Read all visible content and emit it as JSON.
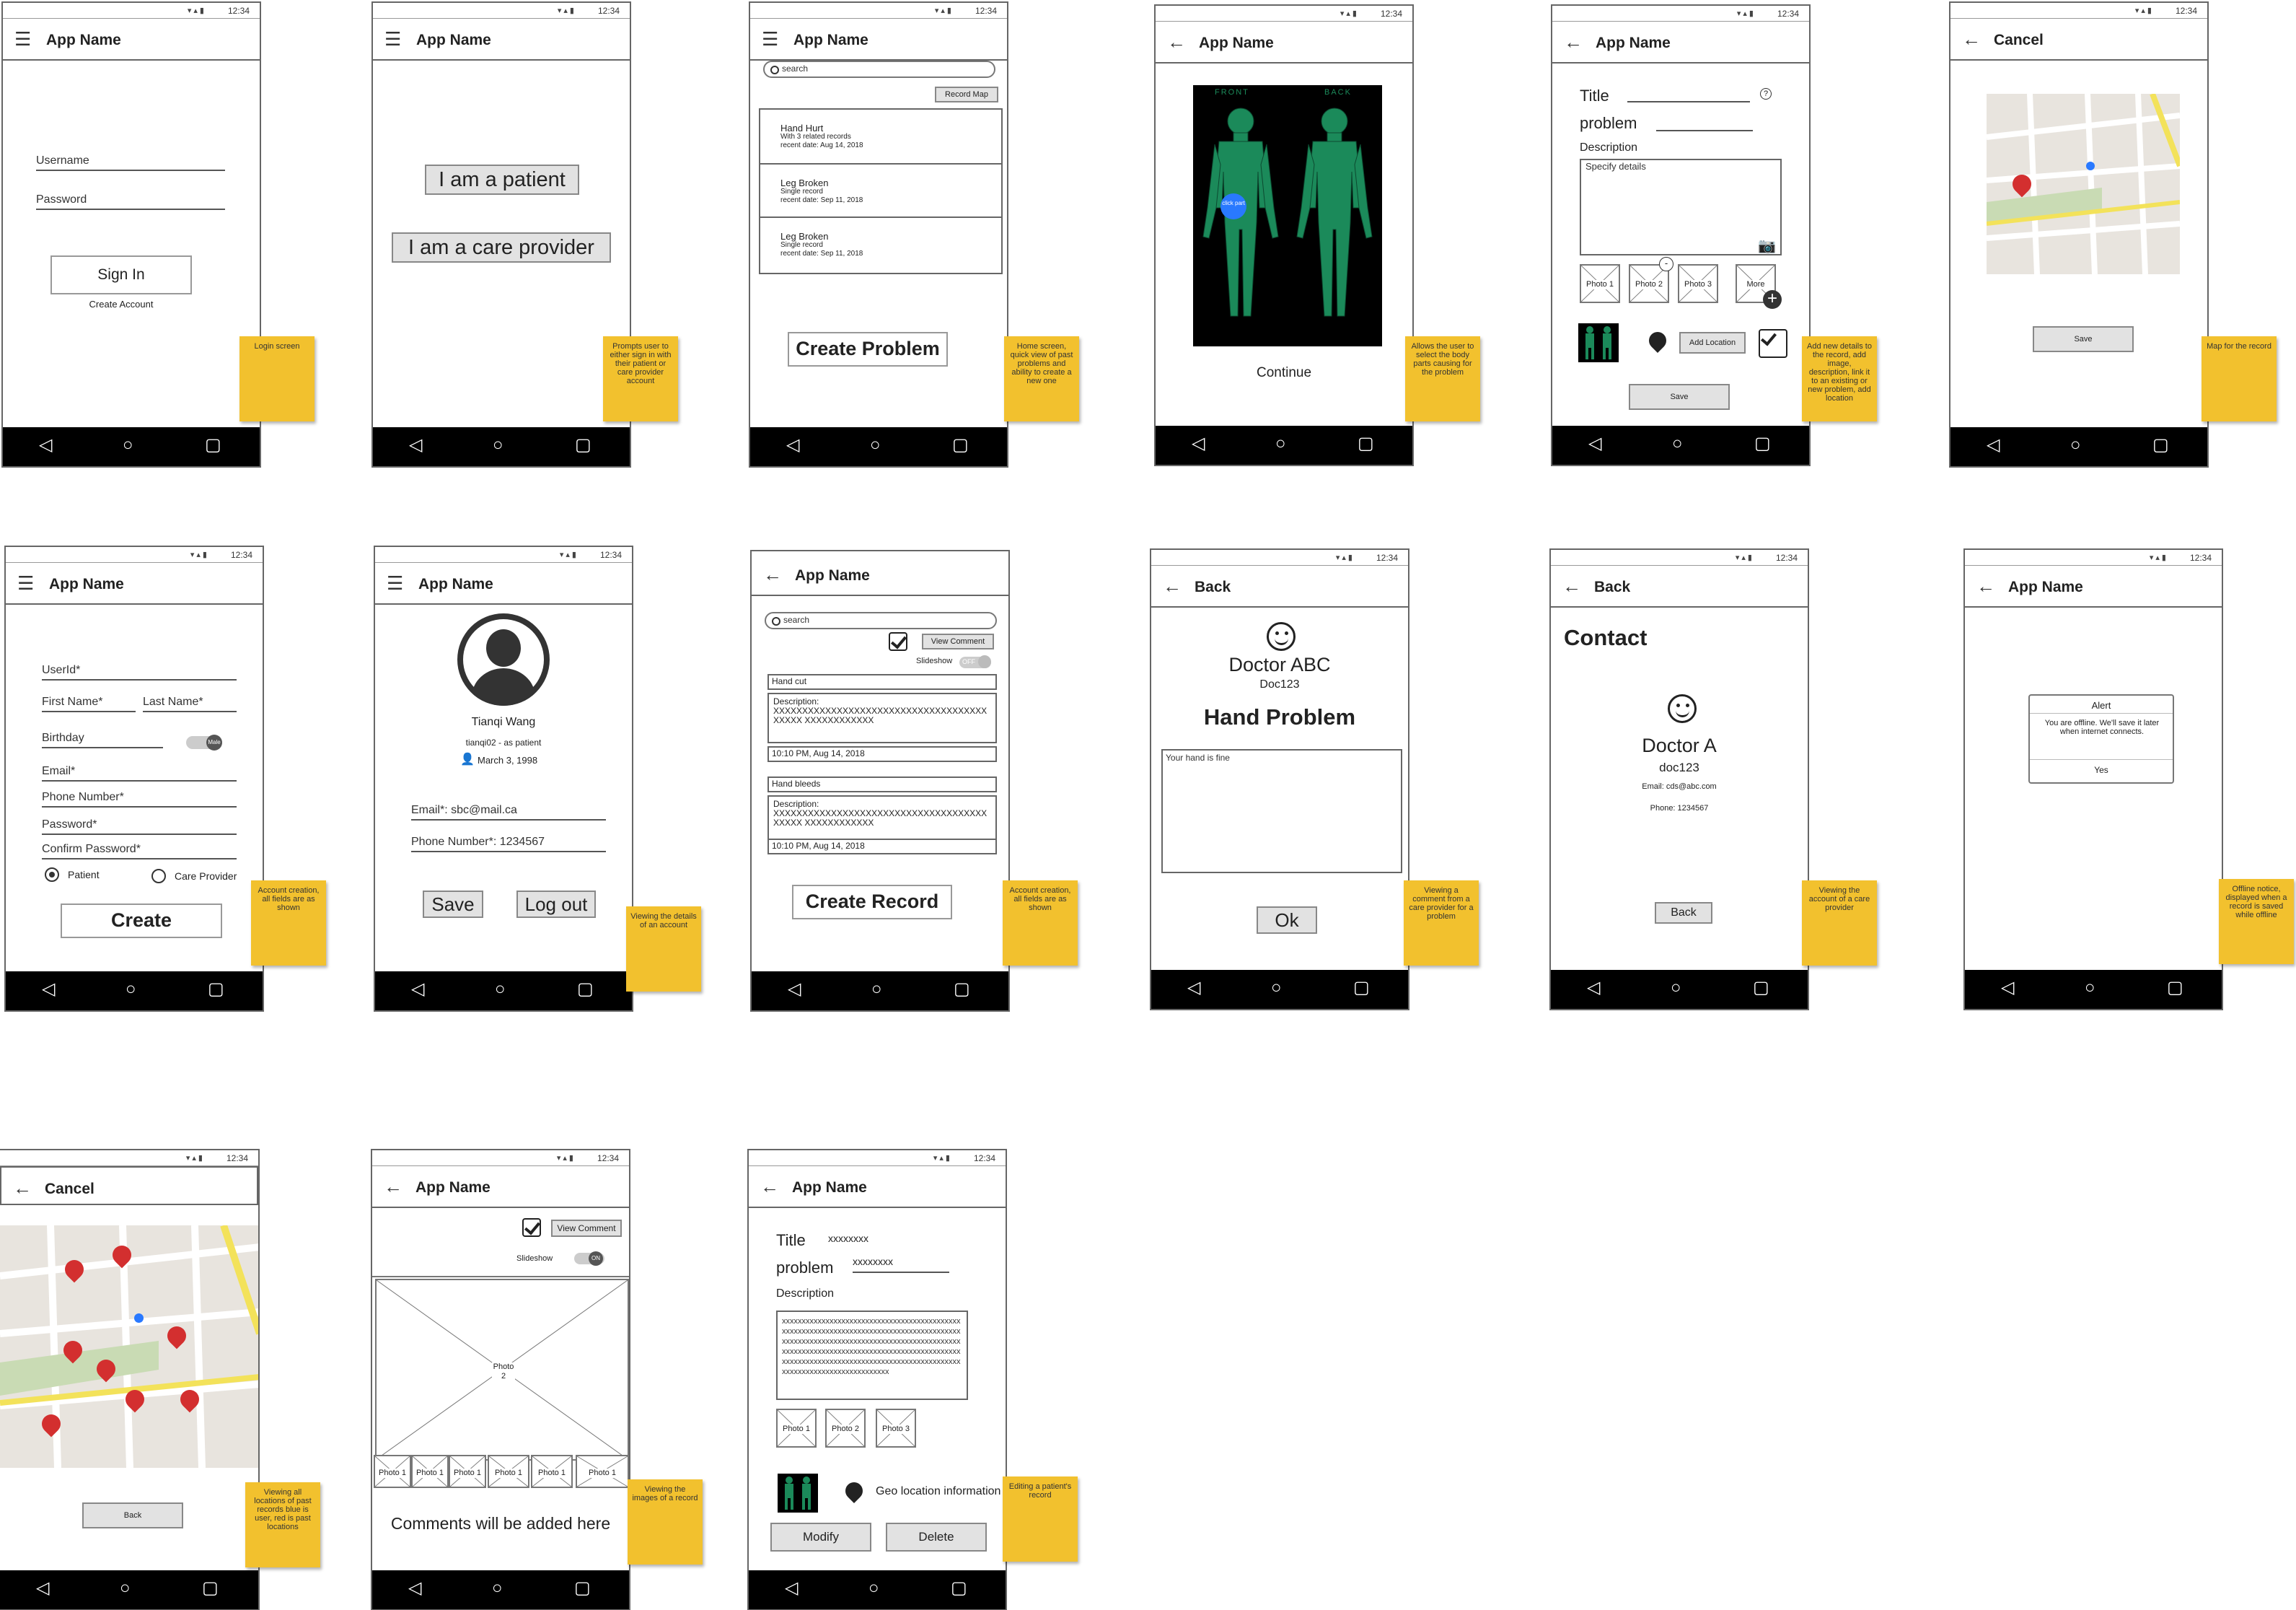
{
  "status": {
    "time": "12:34",
    "icons": "▾▴▮"
  },
  "nav": {
    "back": "◁",
    "home": "○",
    "recent": "▢"
  },
  "icons": {
    "menu": "menu-icon",
    "back": "back-arrow-icon",
    "camera": "camera-icon",
    "pin": "location-pin-icon"
  },
  "colors": {
    "note": "#f2c12e",
    "body": "#1b8a5a",
    "pin": "#d32f2f",
    "user_dot": "#2979ff",
    "road_yellow": "#f3e25a",
    "park": "#c9dbb4"
  },
  "s1": {
    "title": "App Name",
    "username": "Username",
    "password": "Password",
    "signin": "Sign In",
    "create": "Create Account",
    "note": "Login screen"
  },
  "s2": {
    "title": "App Name",
    "patient": "I am a patient",
    "provider": "I am a care provider",
    "note": "Prompts user to either sign in with their patient or care provider account"
  },
  "s3": {
    "title": "App Name",
    "search": "search",
    "record_map": "Record Map",
    "items": [
      {
        "title": "Hand Hurt",
        "sub": "With 3 related records",
        "date": "recent date: Aug 14, 2018"
      },
      {
        "title": "Leg Broken",
        "sub": "Single record",
        "date": "recent date: Sep 11, 2018"
      },
      {
        "title": "Leg Broken",
        "sub": "Single record",
        "date": "recent date: Sep 11, 2018"
      }
    ],
    "create": "Create Problem",
    "note": "Home screen, quick view of past problems and ability to create a new one"
  },
  "s4": {
    "title": "App Name",
    "front": "FRONT",
    "back": "BACK",
    "click": "click part",
    "continue": "Continue",
    "note": "Allows the user to select the body parts causing for the problem"
  },
  "s5": {
    "title": "App Name",
    "title_label": "Title",
    "problem": "problem",
    "description": "Description",
    "placeholder": "Specify details",
    "photos": [
      "Photo 1",
      "Photo 2",
      "Photo 3",
      "More"
    ],
    "minus": "-",
    "add_location": "Add Location",
    "save": "Save",
    "note": "Add new details to the record, add image, description, link it to an existing or new problem, add location"
  },
  "s6": {
    "title": "Cancel",
    "save": "Save",
    "note": "Map for the record"
  },
  "s7": {
    "title": "App Name",
    "userid": "UserId*",
    "first": "First Name*",
    "last": "Last Name*",
    "birthday": "Birthday",
    "toggle": "Male",
    "email": "Email*",
    "phone": "Phone Number*",
    "password": "Password*",
    "confirm": "Confirm Password*",
    "patient": "Patient",
    "provider": "Care Provider",
    "create": "Create",
    "note": "Account creation, all fields are as shown"
  },
  "s8": {
    "title": "App Name",
    "name": "Tianqi Wang",
    "handle": "tianqi02 - as patient",
    "dob": "March 3, 1998",
    "email": "Email*: sbc@mail.ca",
    "phone": "Phone Number*: 1234567",
    "save": "Save",
    "logout": "Log out",
    "note": "Viewing the details of an account"
  },
  "s9": {
    "title": "App Name",
    "search": "search",
    "view_comment": "View Comment",
    "slideshow": "Slideshow",
    "off": "OFF",
    "records": [
      {
        "title": "Hand cut",
        "desc": "Description:\nXXXXXXXXXXXXXXXXXXXXXXXXXXXXXXXXXXXXXXXXXX XXXXXXXXXXXX",
        "time": "10:10 PM, Aug 14, 2018"
      },
      {
        "title": "Hand bleeds",
        "desc": "Description:\nXXXXXXXXXXXXXXXXXXXXXXXXXXXXXXXXXXXXXXXXXX XXXXXXXXXXXX",
        "time": "10:10 PM, Aug 14, 2018"
      }
    ],
    "create": "Create Record",
    "note": "Account creation, all fields are as shown"
  },
  "s10": {
    "title": "Back",
    "doctor": "Doctor ABC",
    "id": "Doc123",
    "problem": "Hand Problem",
    "comment": "Your hand is fine",
    "ok": "Ok",
    "note": "Viewing a comment from a care provider for a problem"
  },
  "s11": {
    "title": "Back",
    "contact": "Contact",
    "doctor": "Doctor A",
    "id": "doc123",
    "email": "Email: cds@abc.com",
    "phone": "Phone: 1234567",
    "back": "Back",
    "note": "Viewing the account of a care provider"
  },
  "s12": {
    "title": "App Name",
    "alert": "Alert",
    "msg": "You are offline. We'll save it later when internet connects.",
    "yes": "Yes",
    "note": "Offline notice, displayed when a record is saved while offline"
  },
  "s13": {
    "title": "Cancel",
    "back": "Back",
    "note": "Viewing all locations of past records blue is user, red is past locations"
  },
  "s14": {
    "title": "App Name",
    "view_comment": "View Comment",
    "slideshow": "Slideshow",
    "on": "ON",
    "main_photo": "Photo 2",
    "thumbs": [
      "Photo 1",
      "Photo 1",
      "Photo 1",
      "Photo 1",
      "Photo 1",
      "Photo 1"
    ],
    "comments": "Comments will be added here",
    "note": "Viewing the images of a record"
  },
  "s15": {
    "title": "App Name",
    "title_label": "Title",
    "title_val": "xxxxxxxx",
    "problem": "problem",
    "problem_val": "xxxxxxxx",
    "description": "Description",
    "desc_val": "xxxxxxxxxxxxxxxxxxxxxxxxxxxxxxxxxxxxxxxxxxxxxxxxxxxxxxxxxxxxxxxxxxxxxxxxxxxxxxxxxxxxxxxxxxxxxxxxxxxxxxxxxxxxxxxxxxxxxxxxxxxxxxxxxxxxxxxxxxxxxxxxxxxxxxxxxxxxxxxxxxxxxxxxxxxxxxxxxxxxxxxxxxxxxxxxxxxxxxxxxxxxxxxxxxxxxxxxxxxxxxxxxxxxxxxxxxxxxxxxxxxxxxxxxxxx",
    "photos": [
      "Photo 1",
      "Photo 2",
      "Photo 3"
    ],
    "geo": "Geo location information",
    "modify": "Modify",
    "delete": "Delete",
    "note": "Editing a patient's record"
  }
}
